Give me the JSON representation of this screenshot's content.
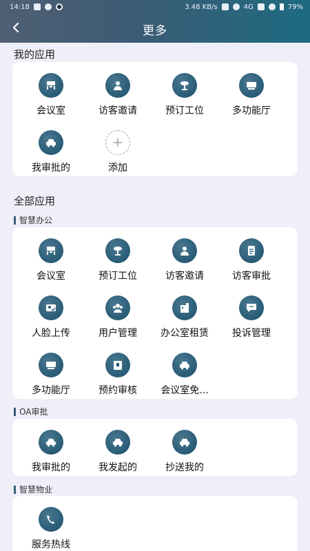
{
  "status_bar": {
    "time": "14:18",
    "net_speed": "3.48 KB/s",
    "network": "4G",
    "battery": "79%"
  },
  "nav": {
    "title": "更多"
  },
  "my_apps": {
    "title": "我的应用",
    "items": [
      {
        "label": "会议室",
        "icon": "meeting-room-icon"
      },
      {
        "label": "访客邀请",
        "icon": "visitor-invite-icon"
      },
      {
        "label": "预订工位",
        "icon": "book-desk-icon"
      },
      {
        "label": "多功能厅",
        "icon": "multipurpose-hall-icon"
      },
      {
        "label": "我审批的",
        "icon": "car-icon"
      },
      {
        "label": "添加",
        "icon": "add-icon"
      }
    ]
  },
  "all_apps": {
    "title": "全部应用",
    "groups": [
      {
        "title": "智慧办公",
        "items": [
          {
            "label": "会议室",
            "icon": "meeting-room-icon"
          },
          {
            "label": "预订工位",
            "icon": "book-desk-icon"
          },
          {
            "label": "访客邀请",
            "icon": "visitor-invite-icon"
          },
          {
            "label": "访客审批",
            "icon": "visitor-approval-icon"
          },
          {
            "label": "人脸上传",
            "icon": "face-upload-icon"
          },
          {
            "label": "用户管理",
            "icon": "user-management-icon"
          },
          {
            "label": "办公室租赁",
            "icon": "office-lease-icon"
          },
          {
            "label": "投诉管理",
            "icon": "complaint-icon"
          },
          {
            "label": "多功能厅",
            "icon": "multipurpose-hall-icon"
          },
          {
            "label": "预约审核",
            "icon": "reservation-review-icon"
          },
          {
            "label": "会议室免...",
            "icon": "car-icon"
          }
        ]
      },
      {
        "title": "OA审批",
        "items": [
          {
            "label": "我审批的",
            "icon": "car-icon"
          },
          {
            "label": "我发起的",
            "icon": "car-icon"
          },
          {
            "label": "抄送我的",
            "icon": "car-icon"
          }
        ]
      },
      {
        "title": "智慧物业",
        "items": [
          {
            "label": "服务热线",
            "icon": "hotline-icon"
          }
        ]
      }
    ]
  },
  "colors": {
    "accent": "#285b76",
    "header_start": "#4f5e74",
    "header_end": "#1d6b80",
    "background": "#eeeff8"
  }
}
